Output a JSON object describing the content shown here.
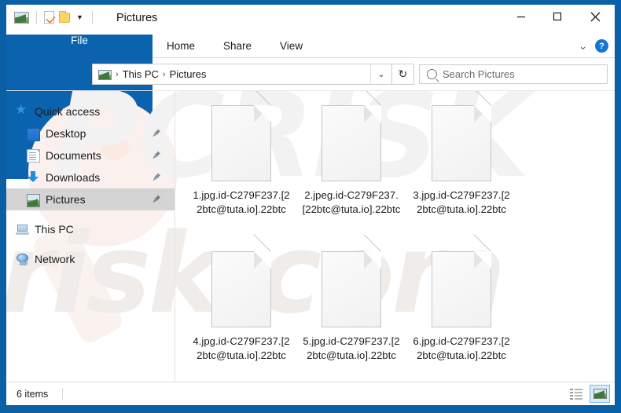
{
  "window": {
    "title": "Pictures",
    "quick_access_toolbar": [
      {
        "name": "pictures-folder-icon",
        "label": "Pictures"
      },
      {
        "name": "properties-icon",
        "label": "Properties"
      },
      {
        "name": "new-folder-icon",
        "label": "New folder"
      },
      {
        "name": "customize-caret-icon",
        "label": "▾"
      }
    ],
    "controls": {
      "minimize": "—",
      "maximize": "▢",
      "close": "✕"
    }
  },
  "ribbon": {
    "tabs": [
      {
        "label": "File",
        "active": true
      },
      {
        "label": "Home",
        "active": false
      },
      {
        "label": "Share",
        "active": false
      },
      {
        "label": "View",
        "active": false
      }
    ],
    "collapse_caret": "⌄",
    "help_label": "?"
  },
  "navigation": {
    "back": "←",
    "forward": "→",
    "recent": "⌄",
    "up": "↑",
    "breadcrumbs": [
      "This PC",
      "Pictures"
    ],
    "separator": "›",
    "address_caret": "⌄",
    "refresh": "↻"
  },
  "search": {
    "placeholder": "Search Pictures",
    "value": ""
  },
  "sidebar": {
    "items": [
      {
        "label": "Quick access",
        "icon": "star-icon",
        "level": 0,
        "pinned": false,
        "selected": false
      },
      {
        "label": "Desktop",
        "icon": "desktop-icon",
        "level": 1,
        "pinned": true,
        "selected": false
      },
      {
        "label": "Documents",
        "icon": "documents-icon",
        "level": 1,
        "pinned": true,
        "selected": false
      },
      {
        "label": "Downloads",
        "icon": "downloads-icon",
        "level": 1,
        "pinned": true,
        "selected": false
      },
      {
        "label": "Pictures",
        "icon": "pictures-icon",
        "level": 1,
        "pinned": true,
        "selected": true
      },
      {
        "label": "This PC",
        "icon": "this-pc-icon",
        "level": 0,
        "pinned": false,
        "selected": false
      },
      {
        "label": "Network",
        "icon": "network-icon",
        "level": 0,
        "pinned": false,
        "selected": false
      }
    ]
  },
  "files": [
    {
      "name": "1.jpg.id-C279F237.[22btc@tuta.io].22btc",
      "icon": "generic-file-icon"
    },
    {
      "name": "2.jpeg.id-C279F237.[22btc@tuta.io].22btc",
      "icon": "generic-file-icon"
    },
    {
      "name": "3.jpg.id-C279F237.[22btc@tuta.io].22btc",
      "icon": "generic-file-icon"
    },
    {
      "name": "4.jpg.id-C279F237.[22btc@tuta.io].22btc",
      "icon": "generic-file-icon"
    },
    {
      "name": "5.jpg.id-C279F237.[22btc@tuta.io].22btc",
      "icon": "generic-file-icon"
    },
    {
      "name": "6.jpg.id-C279F237.[22btc@tuta.io].22btc",
      "icon": "generic-file-icon"
    }
  ],
  "status": {
    "item_count": "6 items",
    "views": [
      {
        "name": "details-view-button",
        "active": false
      },
      {
        "name": "large-icons-view-button",
        "active": true
      }
    ]
  },
  "watermark": {
    "line1": "risk.com",
    "line2": "PCRISK"
  },
  "colors": {
    "accent": "#0b63b0",
    "desktop": "#0b5fa4",
    "selection": "#d4d4d4",
    "view_active": "#d8ecfb"
  }
}
